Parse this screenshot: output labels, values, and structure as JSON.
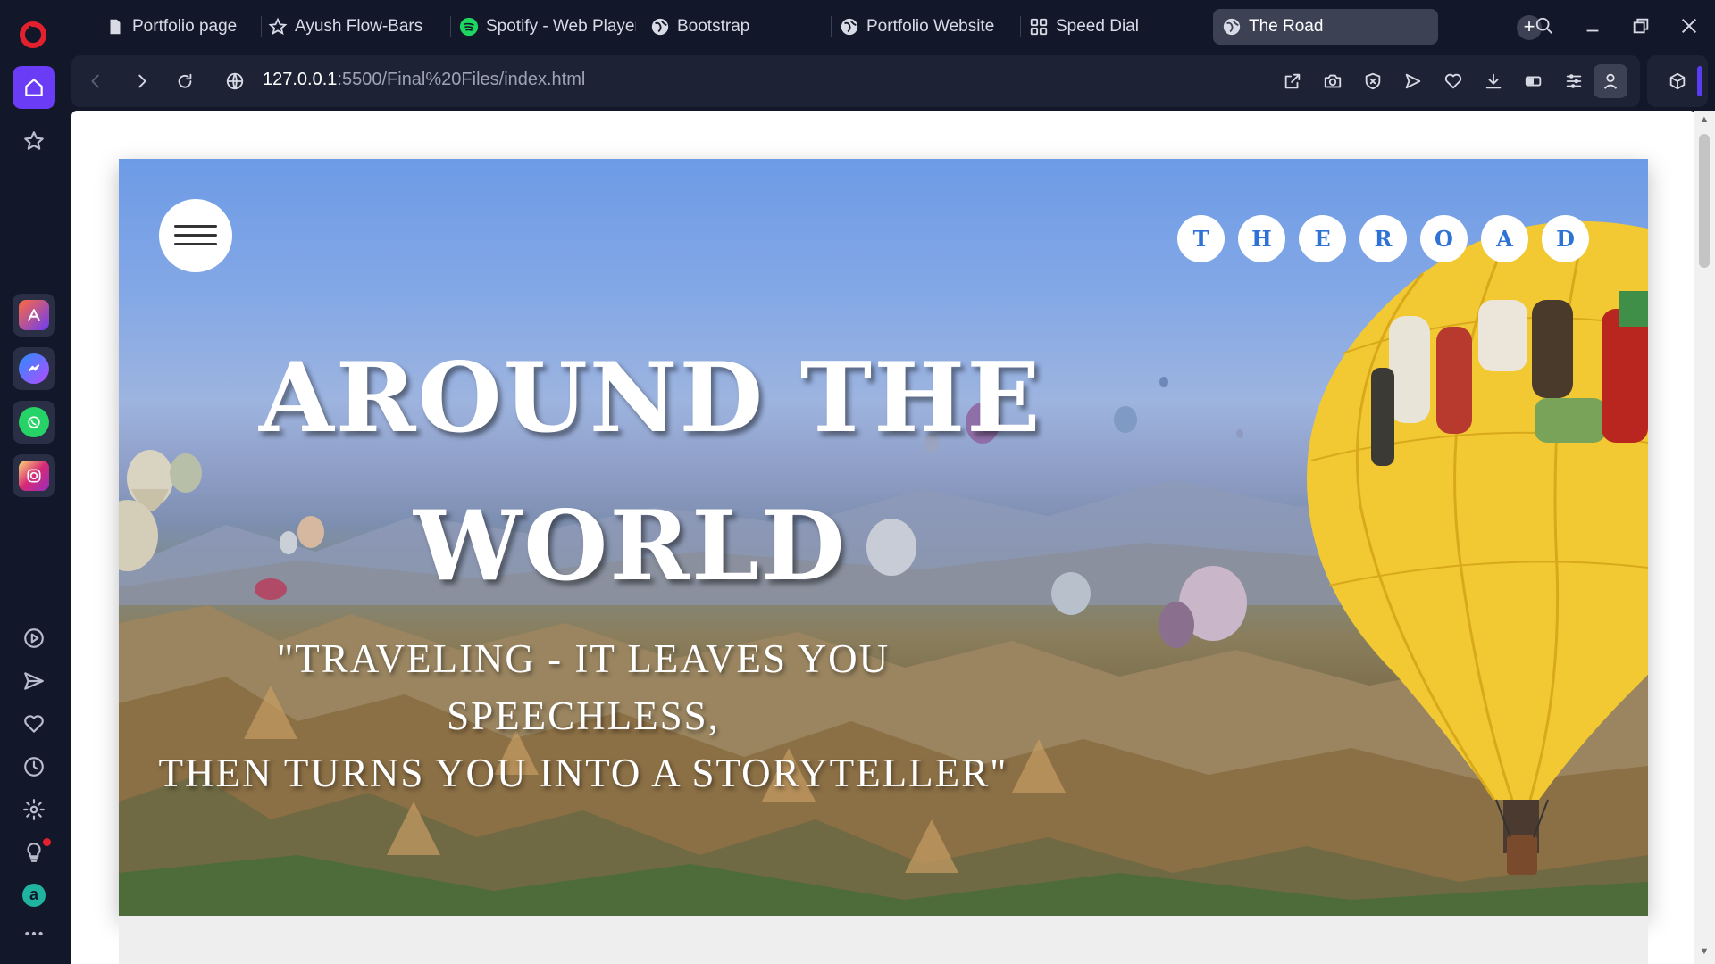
{
  "browser": {
    "tabs": [
      {
        "label": "Portfolio page",
        "icon": "page-icon"
      },
      {
        "label": "Ayush Flow-Bars",
        "icon": "star-badge-icon"
      },
      {
        "label": "Spotify - Web Player",
        "icon": "spotify-icon"
      },
      {
        "label": "Bootstrap",
        "icon": "globe-icon"
      },
      {
        "label": "Portfolio Website",
        "icon": "globe-icon"
      },
      {
        "label": "Speed Dial",
        "icon": "grid-icon"
      },
      {
        "label": "The Road",
        "icon": "globe-icon",
        "active": true
      }
    ],
    "url_host": "127.0.0.1",
    "url_rest": ":5500/Final%20Files/index.html"
  },
  "sidebar": {
    "items": [
      "opera-logo",
      "home",
      "bookmarks",
      "aria",
      "messenger",
      "whatsapp",
      "instagram",
      "player",
      "send",
      "favorites",
      "history",
      "settings",
      "tips",
      "amazon",
      "more"
    ]
  },
  "page": {
    "brand_letters": [
      "T",
      "H",
      "E",
      "R",
      "O",
      "A",
      "D"
    ],
    "headline_line1": "AROUND THE",
    "headline_line2": "WORLD",
    "quote_line1": "\"TRAVELING - IT LEAVES YOU SPEECHLESS,",
    "quote_line2": "THEN TURNS YOU INTO A STORYTELLER\""
  },
  "colors": {
    "accent": "#6b3cf5",
    "brand_letter": "#2f72d6",
    "balloon_yellow": "#f2c933"
  }
}
